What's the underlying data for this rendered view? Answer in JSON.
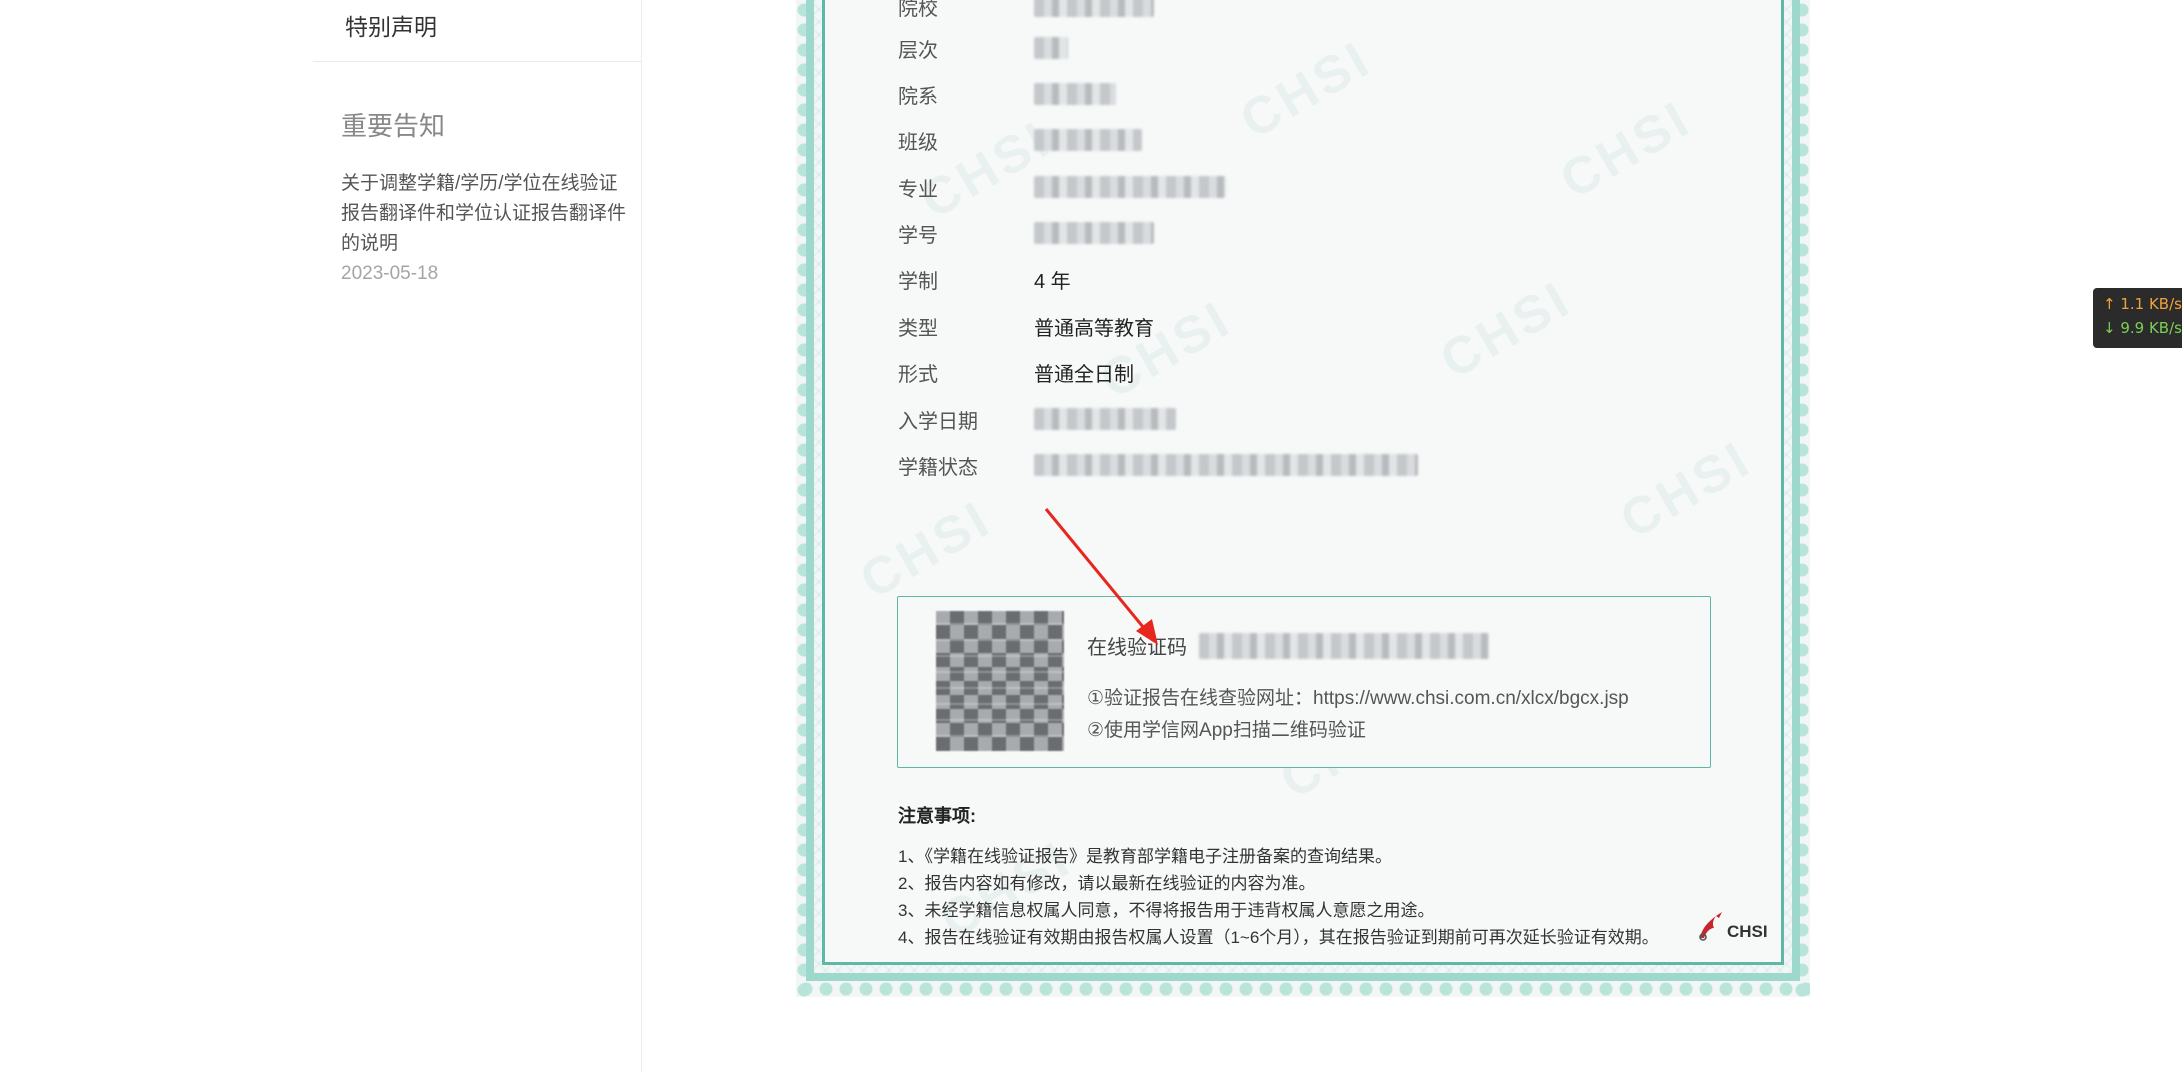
{
  "sidebar": {
    "top_link": "特别声明",
    "notice_heading": "重要告知",
    "notice": {
      "title": "关于调整学籍/学历/学位在线验证报告翻译件和学位认证报告翻译件的说明",
      "date": "2023-05-18"
    }
  },
  "certificate": {
    "rows": [
      {
        "label": "院校",
        "value": ""
      },
      {
        "label": "层次",
        "value": ""
      },
      {
        "label": "院系",
        "value": ""
      },
      {
        "label": "班级",
        "value": ""
      },
      {
        "label": "专业",
        "value": ""
      },
      {
        "label": "学号",
        "value": ""
      },
      {
        "label": "学制",
        "value": "4 年"
      },
      {
        "label": "类型",
        "value": "普通高等教育"
      },
      {
        "label": "形式",
        "value": "普通全日制"
      },
      {
        "label": "入学日期",
        "value": ""
      },
      {
        "label": "学籍状态",
        "value": ""
      }
    ],
    "verify": {
      "code_label": "在线验证码",
      "line1": "①验证报告在线查验网址：https://www.chsi.com.cn/xlcx/bgcx.jsp",
      "line2": "②使用学信网App扫描二维码验证"
    },
    "notes": {
      "title": "注意事项:",
      "items": [
        "1、《学籍在线验证报告》是教育部学籍电子注册备案的查询结果。",
        "2、报告内容如有修改，请以最新在线验证的内容为准。",
        "3、未经学籍信息权属人同意，不得将报告用于违背权属人意愿之用途。",
        "4、报告在线验证有效期由报告权属人设置（1~6个月），其在报告验证到期前可再次延长验证有效期。"
      ]
    },
    "logo_text": "CHSI",
    "watermark_text": "CHSI"
  },
  "speed_widget": {
    "up": "↑ 1.1 KB/s",
    "down": "↓ 9.9 KB/s"
  },
  "colors": {
    "frame": "#9ed7cb",
    "frame_border": "#5fb8a7",
    "arrow": "#e8261e",
    "speed_up": "#f0a23a",
    "speed_down": "#7bcf55"
  }
}
